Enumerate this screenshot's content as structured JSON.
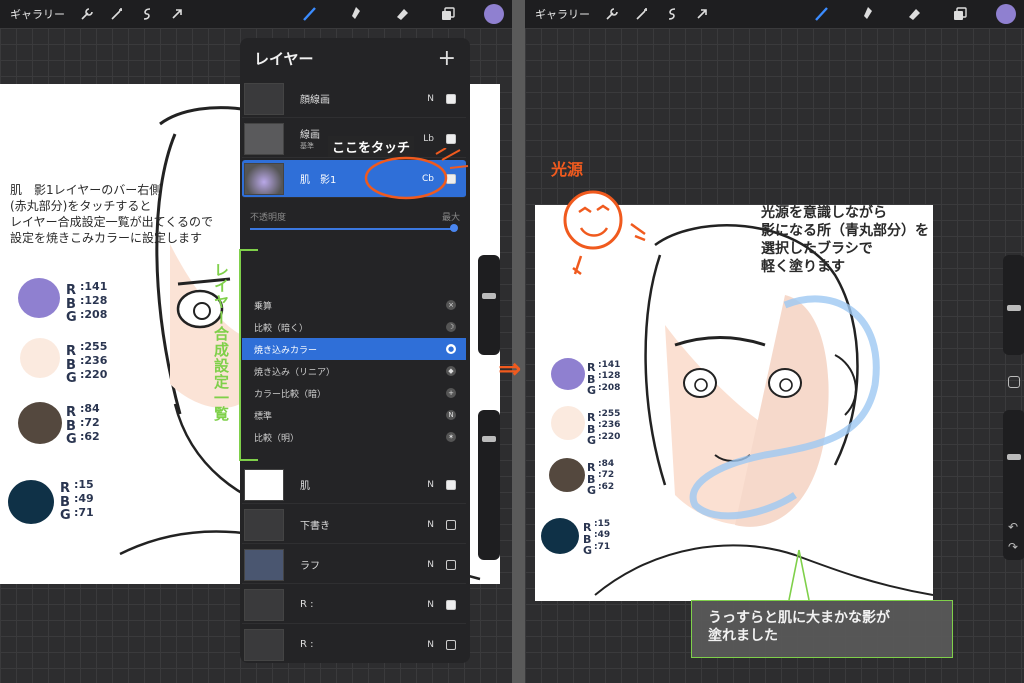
{
  "toolbar": {
    "gallery": "ギャラリー"
  },
  "left_note": {
    "lines": [
      "肌　影1レイヤーのバー右側",
      "(赤丸部分)をタッチすると",
      "レイヤー合成設定一覧が出てくるので",
      "設定を焼きこみカラーに設定します"
    ]
  },
  "touch_label": "ここをタッチ",
  "layers": {
    "title": "レイヤー",
    "plus": "+",
    "rows": [
      {
        "name": "顔線画",
        "mode": "N",
        "checked": true
      },
      {
        "name": "線画",
        "sub": "基準",
        "mode": "Lb",
        "checked": true
      },
      {
        "name": "肌　影1",
        "mode": "Cb",
        "checked": true,
        "selected": true
      }
    ],
    "opacity_label": "不透明度",
    "opacity_max": "最大",
    "blend_modes": [
      {
        "label": "乗算",
        "icon": "×"
      },
      {
        "label": "比較（暗く）",
        "icon": "☽"
      },
      {
        "label": "焼き込みカラー",
        "icon": "●",
        "active": true
      },
      {
        "label": "焼き込み（リニア）",
        "icon": "◆"
      },
      {
        "label": "カラー比較（暗）",
        "icon": "+"
      },
      {
        "label": "標準",
        "icon": "N"
      },
      {
        "label": "比較（明）",
        "icon": "✶"
      }
    ],
    "lower_rows": [
      {
        "name": "肌",
        "mode": "N",
        "checked": true
      },
      {
        "name": "下書き",
        "mode": "N",
        "checked": false
      },
      {
        "name": "ラフ",
        "mode": "N",
        "checked": false
      },
      {
        "name": "R :",
        "mode": "N",
        "checked": true
      },
      {
        "name": "R :",
        "mode": "N",
        "checked": false
      }
    ]
  },
  "blend_list_label": "レイヤー合成設定一覧",
  "swatches": [
    {
      "color": "#8f80d0",
      "letters": [
        "R",
        "B",
        "G"
      ],
      "values": [
        "141",
        "128",
        "208"
      ]
    },
    {
      "color": "#fbeadf",
      "letters": [
        "R",
        "B",
        "G"
      ],
      "values": [
        "255",
        "236",
        "220"
      ]
    },
    {
      "color": "#54483e",
      "letters": [
        "R",
        "B",
        "G"
      ],
      "values": [
        "84",
        "72",
        "62"
      ]
    },
    {
      "color": "#0f3147",
      "letters": [
        "R",
        "B",
        "G"
      ],
      "values": [
        "15",
        "49",
        "71"
      ]
    }
  ],
  "light_source_label": "光源",
  "right_note": {
    "lines": [
      "光源を意識しながら",
      "影になる所（青丸部分）を",
      "選択したブラシで",
      "軽く塗ります"
    ]
  },
  "bottom_note": {
    "lines": [
      "うっすらと肌に大まかな影が",
      "塗れました"
    ]
  },
  "arrow": "⇒",
  "colors": {
    "accent_blue": "#2f6fd8",
    "annotation_orange": "#f05a1e",
    "annotation_green": "#7fd04a"
  }
}
